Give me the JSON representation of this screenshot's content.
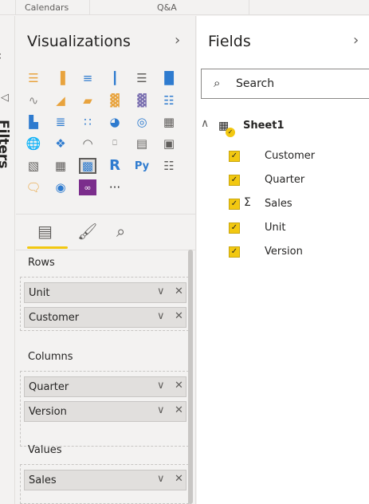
{
  "topbar": {
    "tabs": [
      "Calendars",
      "Q&A"
    ]
  },
  "filters": {
    "label": "Filters"
  },
  "visualizations": {
    "title": "Visualizations",
    "more_label": "···",
    "tabs": [
      "fields-tab",
      "format-tab",
      "analytics-tab"
    ],
    "wells": [
      {
        "label": "Rows",
        "items": [
          "Unit",
          "Customer"
        ]
      },
      {
        "label": "Columns",
        "items": [
          "Quarter",
          "Version"
        ]
      },
      {
        "label": "Values",
        "items": [
          "Sales"
        ]
      }
    ]
  },
  "fields": {
    "title": "Fields",
    "search_placeholder": "Search",
    "table": {
      "name": "Sheet1",
      "items": [
        {
          "name": "Customer",
          "sigma": false
        },
        {
          "name": "Quarter",
          "sigma": false
        },
        {
          "name": "Sales",
          "sigma": true
        },
        {
          "name": "Unit",
          "sigma": false
        },
        {
          "name": "Version",
          "sigma": false
        }
      ]
    }
  },
  "colors": {
    "accent": "#f2c811",
    "pane": "#f3f2f1",
    "chip": "#e1dfdd"
  }
}
